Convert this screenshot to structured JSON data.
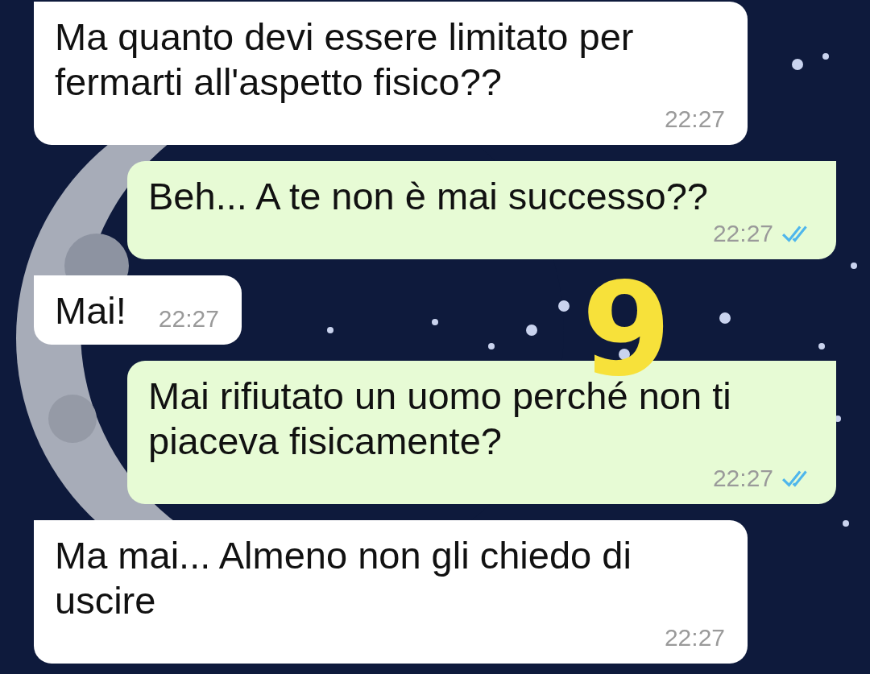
{
  "messages": [
    {
      "kind": "incoming",
      "text": "Ma quanto devi essere limitato per fermarti all'aspetto fisico??",
      "time": "22:27"
    },
    {
      "kind": "outgoing",
      "text": "Beh... A te non è mai successo??",
      "time": "22:27",
      "read": true
    },
    {
      "kind": "incoming",
      "text": "Mai!",
      "time": "22:27"
    },
    {
      "kind": "outgoing",
      "text": "Mai rifiutato un uomo perché non ti piaceva fisicamente?",
      "time": "22:27",
      "read": true
    },
    {
      "kind": "incoming",
      "text": "Ma mai... Almeno non gli chiedo di uscire",
      "time": "22:27"
    }
  ],
  "annotation": {
    "text": "9",
    "color": "#f7e13a"
  }
}
